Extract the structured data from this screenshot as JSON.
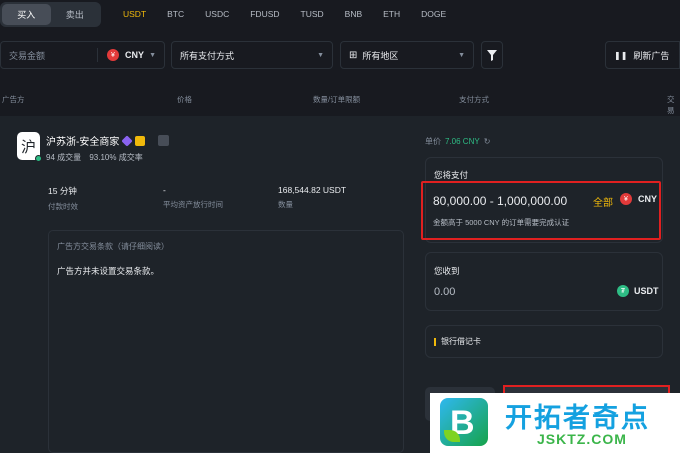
{
  "top": {
    "buy_tab": "买入",
    "sell_tab": "卖出",
    "coins": [
      "USDT",
      "BTC",
      "USDC",
      "FDUSD",
      "TUSD",
      "BNB",
      "ETH",
      "DOGE"
    ]
  },
  "filters": {
    "amount_placeholder": "交易金额",
    "currency": "CNY",
    "payment": "所有支付方式",
    "region": "所有地区",
    "refresh": "刷新广告"
  },
  "table_header": {
    "advertiser": "广告方",
    "price": "价格",
    "limit": "数量/订单限额",
    "payment": "支付方式",
    "trade": "交易"
  },
  "merchant": {
    "avatar_char": "沪",
    "name": "沪苏浙-安全商家",
    "orders": "94 成交量",
    "completion": "93.10% 成交率",
    "pay_time_value": "15 分钟",
    "pay_time_label": "付款时效",
    "release_value": "-",
    "release_label": "平均资产放行时间",
    "quantity_value": "168,544.82 USDT",
    "quantity_label": "数量",
    "terms_title": "广告方交易条款（请仔细阅读）",
    "terms_text": "广告方并未设置交易条款。"
  },
  "order": {
    "unit_price_label": "单价",
    "unit_price_value": "7.06 CNY",
    "pay_label": "您将支付",
    "pay_range": "80,000.00 - 1,000,000.00",
    "all_label": "全部",
    "pay_currency": "CNY",
    "pay_hint": "金额高于 5000 CNY 的订单需要完成认证",
    "receive_label": "您收到",
    "receive_value": "0.00",
    "receive_currency": "USDT",
    "payment_method": "银行借记卡"
  },
  "watermark": {
    "title": "开拓者奇点",
    "url": "JSKTZ.COM"
  },
  "colors": {
    "accent": "#f0b90b",
    "green": "#2ebd85",
    "highlight_red": "#e02020",
    "bg": "#181a20",
    "card": "#1e2329"
  }
}
